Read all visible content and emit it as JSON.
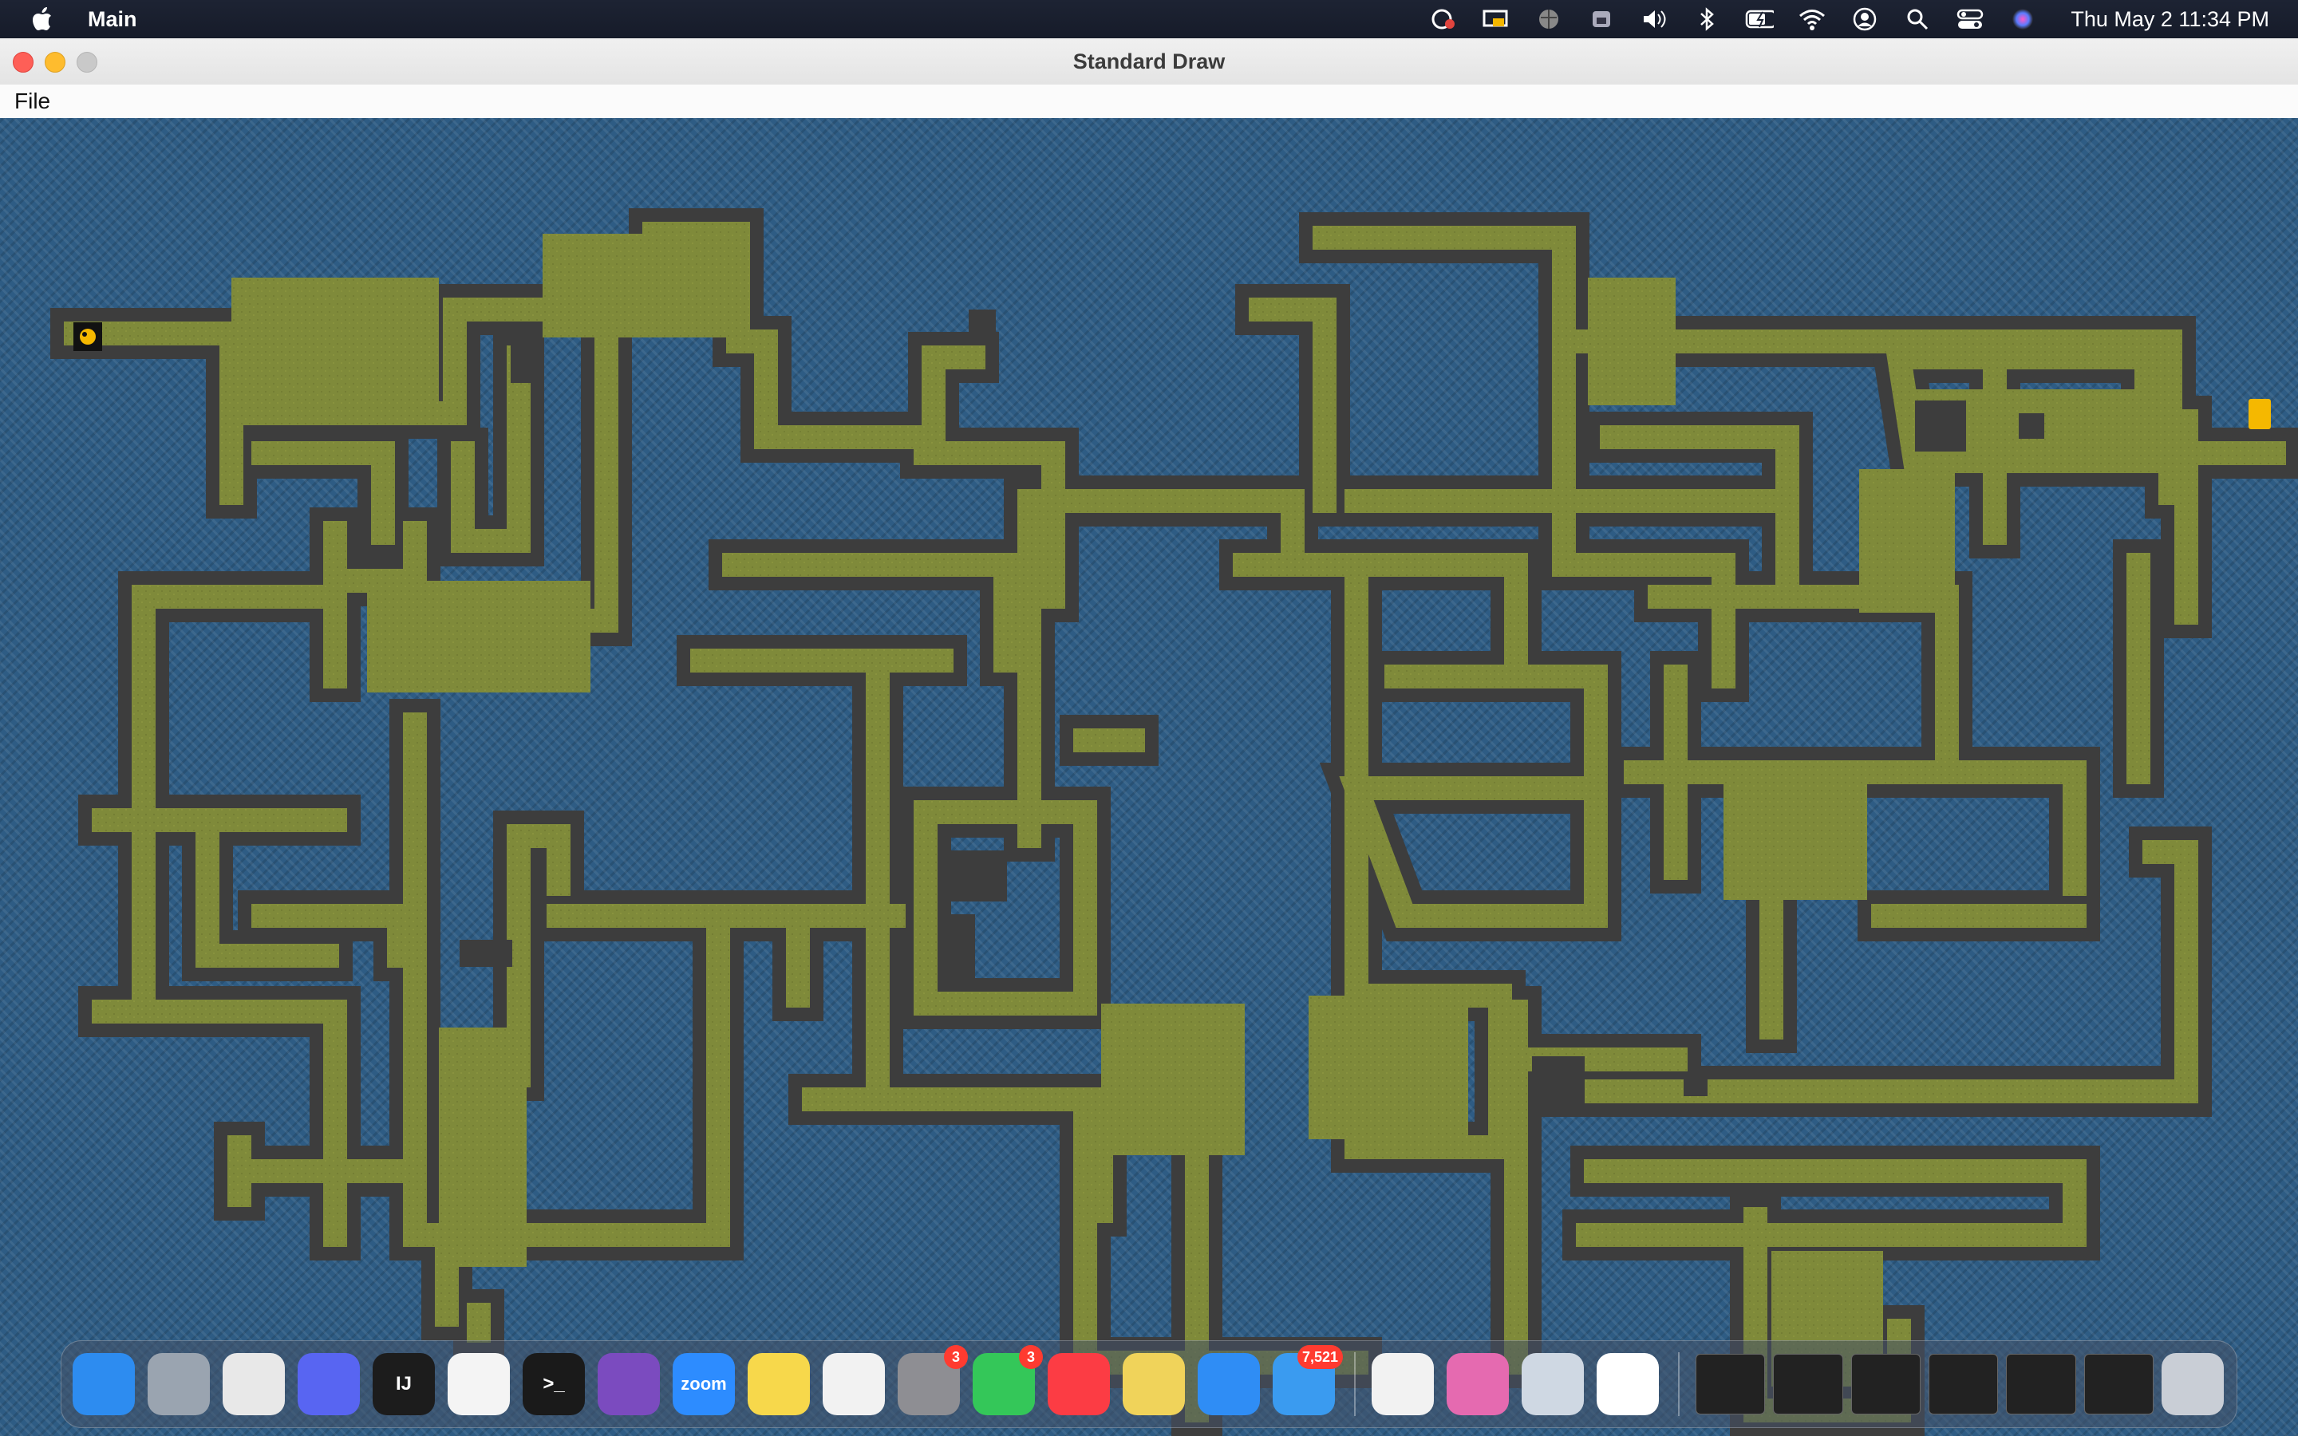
{
  "menubar": {
    "app_name": "Main",
    "clock": "Thu May 2  11:34 PM",
    "status_icons": [
      "screen-record-icon",
      "display-icon",
      "globe-icon",
      "vpn-icon",
      "volume-icon",
      "bluetooth-icon",
      "battery-icon",
      "wifi-icon",
      "user-icon",
      "search-icon",
      "control-center-icon",
      "siri-icon"
    ]
  },
  "window": {
    "title": "Standard Draw",
    "menu": {
      "file": "File"
    }
  },
  "game": {
    "colors": {
      "water": "#2e5c84",
      "wall": "#3d3d3d",
      "floor": "#7f8a3a",
      "player": "#111111",
      "exit": "#f5b800"
    }
  },
  "dock": {
    "apps": [
      {
        "name": "Finder",
        "icon": "finder-icon",
        "color": "#2d8cf0"
      },
      {
        "name": "Launchpad",
        "icon": "launchpad-icon",
        "color": "#9aa4b0"
      },
      {
        "name": "Chrome",
        "icon": "chrome-icon",
        "color": "#e8e8e8"
      },
      {
        "name": "Discord",
        "icon": "discord-icon",
        "color": "#5865f2"
      },
      {
        "name": "IntelliJ IDEA",
        "icon": "intellij-icon",
        "color": "#1c1c1c",
        "label": "IJ"
      },
      {
        "name": "VS Code",
        "icon": "vscode-icon",
        "color": "#f4f4f4"
      },
      {
        "name": "Terminal",
        "icon": "terminal-icon",
        "color": "#1a1a1a",
        "label": ">_"
      },
      {
        "name": "GitHub Desktop",
        "icon": "github-icon",
        "color": "#7b4bbf"
      },
      {
        "name": "Zoom",
        "icon": "zoom-icon",
        "color": "#2d8cff",
        "label": "zoom"
      },
      {
        "name": "Notes",
        "icon": "notes-icon",
        "color": "#f7d84b"
      },
      {
        "name": "Photos",
        "icon": "photos-icon",
        "color": "#f2f2f2"
      },
      {
        "name": "System Settings",
        "icon": "settings-icon",
        "color": "#8e8e93",
        "badge": "3"
      },
      {
        "name": "Messages",
        "icon": "messages-icon",
        "color": "#34c759",
        "badge": "3"
      },
      {
        "name": "Music",
        "icon": "music-icon",
        "color": "#fc3c44"
      },
      {
        "name": "Stickies",
        "icon": "stickies-icon",
        "color": "#f0d35a"
      },
      {
        "name": "Safari",
        "icon": "safari-icon",
        "color": "#2f8df5"
      },
      {
        "name": "Mail",
        "icon": "mail-icon",
        "color": "#3a9bf0",
        "badge": "7,521"
      }
    ],
    "secondary": [
      {
        "name": "Python Launcher",
        "icon": "python-icon",
        "color": "#f2f2f2"
      },
      {
        "name": "CleanMyMac",
        "icon": "cleanmymac-icon",
        "color": "#e56ab0"
      },
      {
        "name": "Preview",
        "icon": "preview-icon",
        "color": "#cfd8e3"
      },
      {
        "name": "Java",
        "icon": "java-icon",
        "color": "#ffffff"
      }
    ],
    "windows": [
      "window-thumb-1",
      "window-thumb-2",
      "window-thumb-3",
      "window-thumb-4",
      "window-thumb-5",
      "window-thumb-6"
    ],
    "trash": "trash-icon"
  }
}
